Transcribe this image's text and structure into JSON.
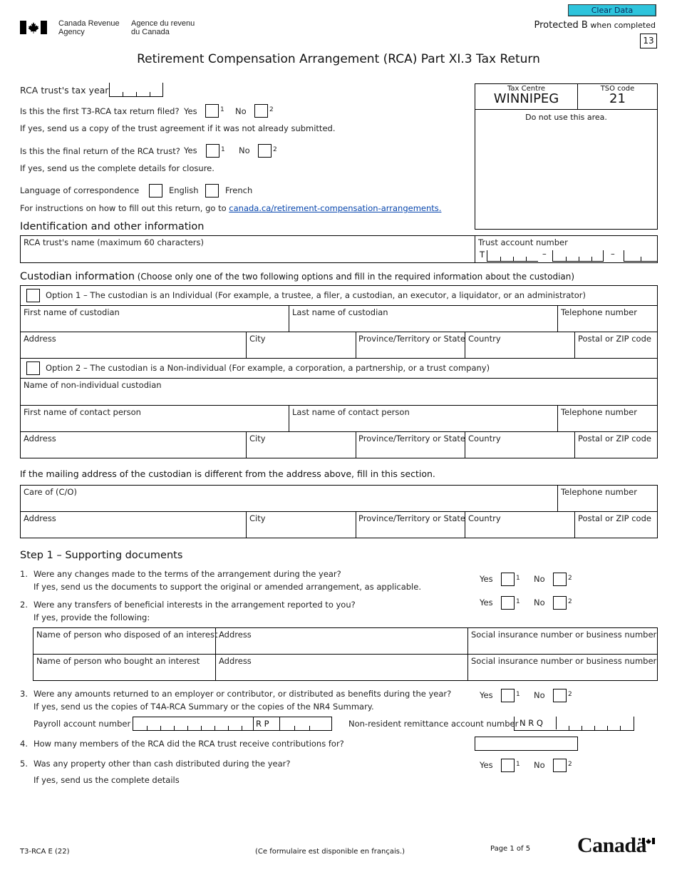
{
  "header": {
    "agency_en_line1": "Canada Revenue",
    "agency_en_line2": "Agency",
    "agency_fr_line1": "Agence du revenu",
    "agency_fr_line2": "du Canada",
    "clear_button": "Clear Data",
    "protected": "Protected B",
    "protected_suffix": "when completed",
    "form_code_box": "13",
    "title": "Retirement Compensation Arrangement (RCA) Part XI.3 Tax Return"
  },
  "tax_centre": {
    "label": "Tax Centre",
    "value": "WINNIPEG",
    "tso_label": "TSO code",
    "tso_value": "21",
    "note": "Do not use this area."
  },
  "intro": {
    "tax_year_label": "RCA trust's tax year",
    "first_return_q": "Is this the first T3-RCA tax return filed?",
    "first_return_note": "If yes, send us a copy of the trust agreement if it was not already submitted.",
    "final_return_q": "Is this the final return of the RCA trust?",
    "final_return_note": "If yes, send us the complete details for closure.",
    "yes": "Yes",
    "no": "No",
    "opt1": "1",
    "opt2": "2",
    "language_label": "Language of correspondence",
    "english": "English",
    "french": "French",
    "instructions_text": "For instructions on how to fill out this return, go to",
    "instructions_link": "canada.ca/retirement-compensation-arrangements."
  },
  "identification": {
    "heading": "Identification and other information",
    "trust_name_label": "RCA trust's name (maximum 60 characters)",
    "trust_account_label": "Trust account number",
    "trust_account_prefix": "T",
    "dash": "–"
  },
  "custodian": {
    "heading": "Custodian information",
    "heading_note": "(Choose only one of the two following options and fill in the required information about the custodian)",
    "option1": "Option 1 – The custodian is an Individual (For example, a trustee, a filer, a custodian, an executor, a liquidator, or an administrator)",
    "first_name": "First name of custodian",
    "last_name": "Last name of custodian",
    "telephone": "Telephone number",
    "address": "Address",
    "city": "City",
    "province": "Province/Territory or State",
    "country": "Country",
    "postal": "Postal or ZIP code",
    "option2": "Option 2 – The custodian is a Non-individual (For example, a corporation, a partnership, or a trust company)",
    "non_individual_name": "Name of non-individual custodian",
    "contact_first": "First name of contact person",
    "contact_last": "Last name of contact person",
    "mailing_note": "If the mailing address of the custodian is different from the address above, fill in this section.",
    "care_of": "Care of (C/O)"
  },
  "step1": {
    "heading": "Step 1 – Supporting documents",
    "q1_num": "1.",
    "q1": "Were any changes made to the terms of the arrangement during the year?",
    "q1_note": "If yes, send us the documents to support the original or amended arrangement, as applicable.",
    "q2_num": "2.",
    "q2": "Were any transfers of beneficial interests in the arrangement reported to you?",
    "q2_note": "If yes, provide the following:",
    "disposed_label": "Name of person who disposed of an interest",
    "bought_label": "Name of person who bought an interest",
    "address": "Address",
    "sin_label": "Social insurance number or business number",
    "q3_num": "3.",
    "q3": "Were any amounts returned to an employer or contributor, or distributed as benefits during the year?",
    "q3_note": "If yes, send us the copies of T4A-RCA Summary or the copies of the NR4 Summary.",
    "payroll_label": "Payroll account number",
    "payroll_prog": "R  P",
    "nr_label": "Non-resident remittance account number",
    "nr_prefix": "N  R  Q",
    "q4_num": "4.",
    "q4": "How many members of the RCA did the RCA trust receive contributions for?",
    "q5_num": "5.",
    "q5": "Was any property other than cash distributed during the year?",
    "q5_note": "If yes, send us the complete details"
  },
  "footer": {
    "form_id": "T3-RCA E (22)",
    "french_note": "(Ce formulaire est disponible en français.)",
    "page": "Page 1 of 5",
    "wordmark": "Canadä"
  }
}
